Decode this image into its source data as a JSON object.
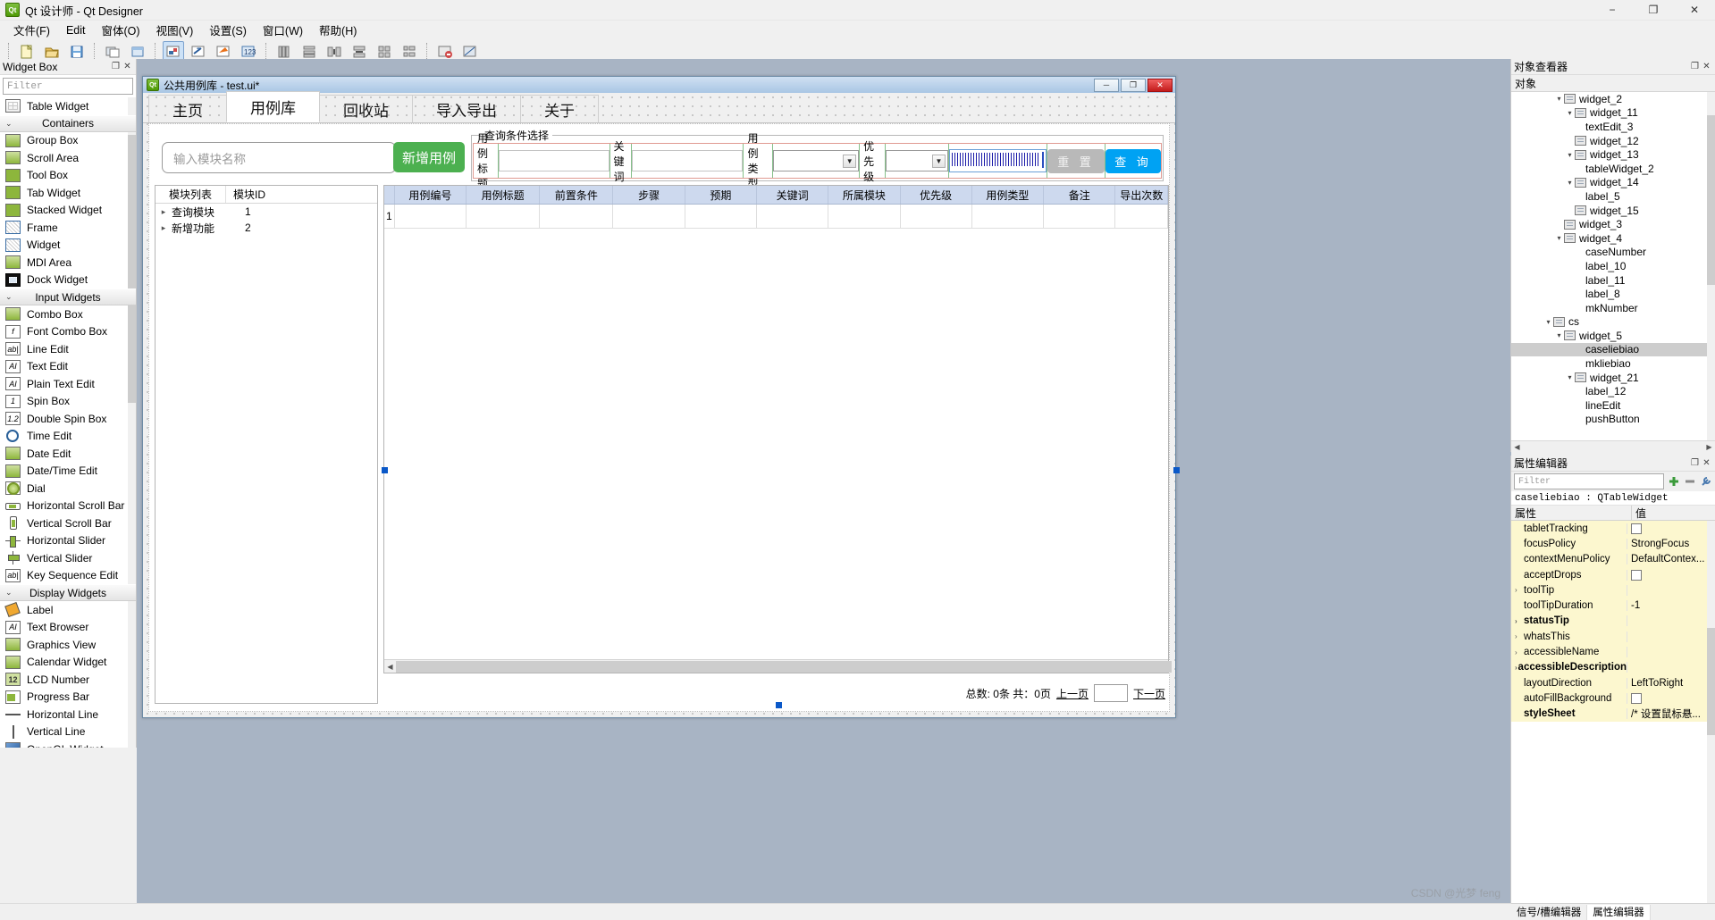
{
  "window": {
    "title": "Qt 设计师 - Qt Designer",
    "logo": "qt-logo",
    "minimize": "−",
    "maximize": "❐",
    "close": "✕"
  },
  "menubar": {
    "items": [
      {
        "label": "文件(F)"
      },
      {
        "label": "Edit"
      },
      {
        "label": "窗体(O)"
      },
      {
        "label": "视图(V)"
      },
      {
        "label": "设置(S)"
      },
      {
        "label": "窗口(W)"
      },
      {
        "label": "帮助(H)"
      }
    ]
  },
  "toolbar": {
    "groups": [
      [
        "new-file-icon",
        "open-file-icon",
        "save-file-icon"
      ],
      [
        "widget-edit-icon",
        "widget-form-icon"
      ],
      [
        "edit-widgets-icon",
        "edit-signals-icon",
        "edit-buddies-icon",
        "edit-tab-order-icon"
      ],
      [
        "layout-vertical-icon",
        "layout-horizontal-icon",
        "layout-splitter-h-icon",
        "layout-splitter-v-icon",
        "layout-grid-icon",
        "layout-form-icon"
      ],
      [
        "break-layout-icon",
        "adjust-size-icon"
      ]
    ]
  },
  "widget_box": {
    "title": "Widget Box",
    "float_btn": "❐",
    "close_btn": "✕",
    "filter_placeholder": "Filter",
    "entries": [
      {
        "type": "item",
        "label": "Table Widget",
        "icon": "table-widget-icon",
        "style": "tbl"
      },
      {
        "type": "cat",
        "label": "Containers",
        "icon": "chevron-down-icon"
      },
      {
        "type": "item",
        "label": "Group Box",
        "icon": "group-box-icon",
        "style": "gr"
      },
      {
        "type": "item",
        "label": "Scroll Area",
        "icon": "scroll-area-icon",
        "style": "gr"
      },
      {
        "type": "item",
        "label": "Tool Box",
        "icon": "tool-box-icon",
        "style": "g"
      },
      {
        "type": "item",
        "label": "Tab Widget",
        "icon": "tab-widget-icon",
        "style": "g"
      },
      {
        "type": "item",
        "label": "Stacked Widget",
        "icon": "stacked-widget-icon",
        "style": "g"
      },
      {
        "type": "item",
        "label": "Frame",
        "icon": "frame-icon",
        "style": "bl"
      },
      {
        "type": "item",
        "label": "Widget",
        "icon": "widget-icon",
        "style": "bl"
      },
      {
        "type": "item",
        "label": "MDI Area",
        "icon": "mdi-area-icon",
        "style": "gr"
      },
      {
        "type": "item",
        "label": "Dock Widget",
        "icon": "dock-widget-icon",
        "style": "dark"
      },
      {
        "type": "cat",
        "label": "Input Widgets",
        "icon": "chevron-down-icon"
      },
      {
        "type": "item",
        "label": "Combo Box",
        "icon": "combo-box-icon",
        "style": "gr"
      },
      {
        "type": "item",
        "label": "Font Combo Box",
        "icon": "font-combo-box-icon",
        "style": "txt",
        "glyph": "f"
      },
      {
        "type": "item",
        "label": "Line Edit",
        "icon": "line-edit-icon",
        "style": "txt",
        "glyph": "ab|"
      },
      {
        "type": "item",
        "label": "Text Edit",
        "icon": "text-edit-icon",
        "style": "txt",
        "glyph": "AI"
      },
      {
        "type": "item",
        "label": "Plain Text Edit",
        "icon": "plain-text-edit-icon",
        "style": "txt",
        "glyph": "AI"
      },
      {
        "type": "item",
        "label": "Spin Box",
        "icon": "spin-box-icon",
        "style": "txt",
        "glyph": "1"
      },
      {
        "type": "item",
        "label": "Double Spin Box",
        "icon": "double-spin-box-icon",
        "style": "txt",
        "glyph": "1.2"
      },
      {
        "type": "item",
        "label": "Time Edit",
        "icon": "time-edit-icon",
        "style": "circ"
      },
      {
        "type": "item",
        "label": "Date Edit",
        "icon": "date-edit-icon",
        "style": "gr"
      },
      {
        "type": "item",
        "label": "Date/Time Edit",
        "icon": "datetime-edit-icon",
        "style": "gr"
      },
      {
        "type": "item",
        "label": "Dial",
        "icon": "dial-icon",
        "style": "dial"
      },
      {
        "type": "item",
        "label": "Horizontal Scroll Bar",
        "icon": "h-scrollbar-icon",
        "style": "hsb"
      },
      {
        "type": "item",
        "label": "Vertical Scroll Bar",
        "icon": "v-scrollbar-icon",
        "style": "vsb"
      },
      {
        "type": "item",
        "label": "Horizontal Slider",
        "icon": "h-slider-icon",
        "style": "hsl"
      },
      {
        "type": "item",
        "label": "Vertical Slider",
        "icon": "v-slider-icon",
        "style": "vsl"
      },
      {
        "type": "item",
        "label": "Key Sequence Edit",
        "icon": "key-sequence-edit-icon",
        "style": "txt",
        "glyph": "ab|"
      },
      {
        "type": "cat",
        "label": "Display Widgets",
        "icon": "chevron-down-icon"
      },
      {
        "type": "item",
        "label": "Label",
        "icon": "label-icon",
        "style": "label"
      },
      {
        "type": "item",
        "label": "Text Browser",
        "icon": "text-browser-icon",
        "style": "txt",
        "glyph": "AI"
      },
      {
        "type": "item",
        "label": "Graphics View",
        "icon": "graphics-view-icon",
        "style": "gr"
      },
      {
        "type": "item",
        "label": "Calendar Widget",
        "icon": "calendar-widget-icon",
        "style": "gr"
      },
      {
        "type": "item",
        "label": "LCD Number",
        "icon": "lcd-number-icon",
        "style": "lcd",
        "glyph": "12"
      },
      {
        "type": "item",
        "label": "Progress Bar",
        "icon": "progress-bar-icon",
        "style": "pbar"
      },
      {
        "type": "item",
        "label": "Horizontal Line",
        "icon": "h-line-icon",
        "style": "hline"
      },
      {
        "type": "item",
        "label": "Vertical Line",
        "icon": "v-line-icon",
        "style": "vline"
      },
      {
        "type": "item",
        "label": "OpenGL Widget",
        "icon": "opengl-widget-icon",
        "style": "gl"
      }
    ]
  },
  "form": {
    "title": "公共用例库 - test.ui*",
    "minimize": "─",
    "restore": "❐",
    "close": "✕",
    "tabs": [
      {
        "label": "主页",
        "active": false
      },
      {
        "label": "用例库",
        "active": true
      },
      {
        "label": "回收站",
        "active": false
      },
      {
        "label": "导入导出",
        "active": false
      },
      {
        "label": "关于",
        "active": false
      }
    ],
    "module_search_placeholder": "输入模块名称",
    "add_case_button": "新增用例",
    "query_group_title": "查询条件选择",
    "query_fields": [
      {
        "label": "用例标题",
        "kind": "text",
        "value": ""
      },
      {
        "label": "关键词",
        "kind": "text",
        "value": ""
      },
      {
        "label": "用例类型",
        "kind": "combo",
        "value": ""
      },
      {
        "label": "优先级",
        "kind": "combo",
        "value": ""
      }
    ],
    "selected_line_edit": "selected-line-edit",
    "reset_button": "重 置",
    "query_button": "查 询",
    "module_tree": {
      "headers": [
        "模块列表",
        "模块ID"
      ],
      "rows": [
        {
          "name": "查询模块",
          "id": "1"
        },
        {
          "name": "新增功能",
          "id": "2"
        }
      ]
    },
    "case_table": {
      "headers": [
        "用例编号",
        "用例标题",
        "前置条件",
        "步骤",
        "预期",
        "关键词",
        "所属模块",
        "优先级",
        "用例类型",
        "备注",
        "导出次数"
      ],
      "rows": [
        {
          "num": "1",
          "cells": [
            "",
            "",
            "",
            "",
            "",
            "",
            "",
            "",
            "",
            "",
            ""
          ]
        }
      ]
    },
    "footer": {
      "summary": "总数: 0条  共：0页",
      "prev_page": "上一页",
      "page_input": "",
      "next_page": "下一页"
    }
  },
  "object_inspector": {
    "title": "对象查看器",
    "float_btn": "❐",
    "close_btn": "✕",
    "header": "对象",
    "rows": [
      {
        "label": "widget_2",
        "indent": 4,
        "chev": "▾",
        "icon": true,
        "selected": false
      },
      {
        "label": "widget_11",
        "indent": 5,
        "chev": "▾",
        "icon": true,
        "selected": false
      },
      {
        "label": "textEdit_3",
        "indent": 6,
        "chev": "",
        "icon": false,
        "selected": false
      },
      {
        "label": "widget_12",
        "indent": 5,
        "chev": "",
        "icon": true,
        "selected": false
      },
      {
        "label": "widget_13",
        "indent": 5,
        "chev": "▾",
        "icon": true,
        "selected": false
      },
      {
        "label": "tableWidget_2",
        "indent": 6,
        "chev": "",
        "icon": false,
        "selected": false
      },
      {
        "label": "widget_14",
        "indent": 5,
        "chev": "▾",
        "icon": true,
        "selected": false
      },
      {
        "label": "label_5",
        "indent": 6,
        "chev": "",
        "icon": false,
        "selected": false
      },
      {
        "label": "widget_15",
        "indent": 5,
        "chev": "",
        "icon": true,
        "selected": false
      },
      {
        "label": "widget_3",
        "indent": 4,
        "chev": "",
        "icon": true,
        "selected": false
      },
      {
        "label": "widget_4",
        "indent": 4,
        "chev": "▾",
        "icon": true,
        "selected": false
      },
      {
        "label": "caseNumber",
        "indent": 6,
        "chev": "",
        "icon": false,
        "selected": false
      },
      {
        "label": "label_10",
        "indent": 6,
        "chev": "",
        "icon": false,
        "selected": false
      },
      {
        "label": "label_11",
        "indent": 6,
        "chev": "",
        "icon": false,
        "selected": false
      },
      {
        "label": "label_8",
        "indent": 6,
        "chev": "",
        "icon": false,
        "selected": false
      },
      {
        "label": "mkNumber",
        "indent": 6,
        "chev": "",
        "icon": false,
        "selected": false
      },
      {
        "label": "cs",
        "indent": 3,
        "chev": "▾",
        "icon": true,
        "selected": false
      },
      {
        "label": "widget_5",
        "indent": 4,
        "chev": "▾",
        "icon": true,
        "selected": false
      },
      {
        "label": "caseliebiao",
        "indent": 6,
        "chev": "",
        "icon": false,
        "selected": true
      },
      {
        "label": "mkliebiao",
        "indent": 6,
        "chev": "",
        "icon": false,
        "selected": false
      },
      {
        "label": "widget_21",
        "indent": 5,
        "chev": "▾",
        "icon": true,
        "selected": false
      },
      {
        "label": "label_12",
        "indent": 6,
        "chev": "",
        "icon": false,
        "selected": false
      },
      {
        "label": "lineEdit",
        "indent": 6,
        "chev": "",
        "icon": false,
        "selected": false
      },
      {
        "label": "pushButton",
        "indent": 6,
        "chev": "",
        "icon": false,
        "selected": false
      }
    ]
  },
  "property_editor": {
    "title": "属性编辑器",
    "float_btn": "❐",
    "close_btn": "✕",
    "filter_placeholder": "Filter",
    "add_icon": "plus-icon",
    "remove_icon": "minus-icon",
    "config_icon": "wrench-icon",
    "object_line": "caseliebiao : QTableWidget",
    "col_headers": [
      "属性",
      "值"
    ],
    "rows": [
      {
        "key": "tabletTracking",
        "value": "",
        "type": "check",
        "checked": false,
        "bold": false,
        "expand": false,
        "highlight": true
      },
      {
        "key": "focusPolicy",
        "value": "StrongFocus",
        "type": "text",
        "bold": false,
        "expand": false,
        "highlight": true
      },
      {
        "key": "contextMenuPolicy",
        "value": "DefaultContex...",
        "type": "text",
        "bold": false,
        "expand": false,
        "highlight": true
      },
      {
        "key": "acceptDrops",
        "value": "",
        "type": "check",
        "checked": false,
        "bold": false,
        "expand": false,
        "highlight": true
      },
      {
        "key": "toolTip",
        "value": "",
        "type": "text",
        "bold": false,
        "expand": true,
        "highlight": true
      },
      {
        "key": "toolTipDuration",
        "value": "-1",
        "type": "text",
        "bold": false,
        "expand": false,
        "highlight": true
      },
      {
        "key": "statusTip",
        "value": "",
        "type": "text",
        "bold": true,
        "expand": true,
        "highlight": true
      },
      {
        "key": "whatsThis",
        "value": "",
        "type": "text",
        "bold": false,
        "expand": true,
        "highlight": true
      },
      {
        "key": "accessibleName",
        "value": "",
        "type": "text",
        "bold": false,
        "expand": true,
        "highlight": true
      },
      {
        "key": "accessibleDescription",
        "value": "",
        "type": "text",
        "bold": true,
        "expand": true,
        "highlight": true
      },
      {
        "key": "layoutDirection",
        "value": "LeftToRight",
        "type": "text",
        "bold": false,
        "expand": false,
        "highlight": true
      },
      {
        "key": "autoFillBackground",
        "value": "",
        "type": "check",
        "checked": false,
        "bold": false,
        "expand": false,
        "highlight": true
      },
      {
        "key": "styleSheet",
        "value": "/* 设置鼠标悬...",
        "type": "text",
        "bold": true,
        "expand": false,
        "highlight": true
      }
    ],
    "bottom_tabs": [
      {
        "label": "信号/槽编辑器",
        "active": false
      },
      {
        "label": "属性编辑器",
        "active": true
      }
    ]
  },
  "watermark": "CSDN @光梦 feng"
}
